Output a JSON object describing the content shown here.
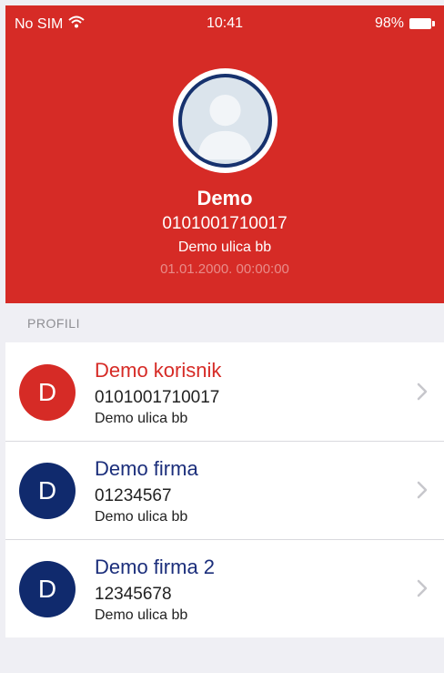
{
  "status_bar": {
    "carrier": "No SIM",
    "time": "10:41",
    "battery": "98%"
  },
  "profile": {
    "name": "Demo",
    "id": "0101001710017",
    "address": "Demo ulica bb",
    "datetime": "01.01.2000. 00:00:00"
  },
  "section": {
    "label": "PROFILI"
  },
  "profiles": [
    {
      "initial": "D",
      "title": "Demo korisnik",
      "id": "0101001710017",
      "address": "Demo ulica bb",
      "avatar_color": "#d62b26",
      "title_color": "#d62b26"
    },
    {
      "initial": "D",
      "title": "Demo firma",
      "id": "01234567",
      "address": "Demo ulica bb",
      "avatar_color": "#102a6d",
      "title_color": "#1b2e7b"
    },
    {
      "initial": "D",
      "title": "Demo firma 2",
      "id": "12345678",
      "address": "Demo ulica bb",
      "avatar_color": "#102a6d",
      "title_color": "#1b2e7b"
    }
  ],
  "colors": {
    "header_bg": "#d62b26",
    "avatar_ring": "#17326e"
  },
  "icons": {
    "wifi": "wifi-icon",
    "battery": "battery-icon",
    "avatar": "user-placeholder-icon",
    "chevron": "chevron-right-icon"
  }
}
